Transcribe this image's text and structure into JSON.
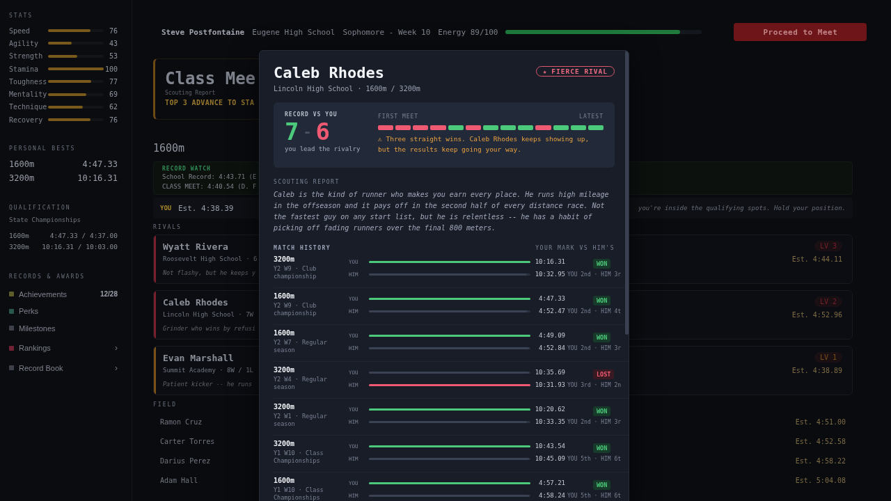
{
  "sidebar": {
    "stats_title": "STATS",
    "stats": [
      {
        "name": "Speed",
        "value": "76",
        "level": 0.76
      },
      {
        "name": "Agility",
        "value": "43",
        "level": 0.43
      },
      {
        "name": "Strength",
        "value": "53",
        "level": 0.53
      },
      {
        "name": "Stamina",
        "value": "100",
        "level": 1.0
      },
      {
        "name": "Toughness",
        "value": "77",
        "level": 0.77
      },
      {
        "name": "Mentality",
        "value": "69",
        "level": 0.69
      },
      {
        "name": "Technique",
        "value": "62",
        "level": 0.62
      },
      {
        "name": "Recovery",
        "value": "76",
        "level": 0.76
      }
    ],
    "bests_title": "PERSONAL BESTS",
    "bests": [
      {
        "event": "1600m",
        "time": "4:47.33"
      },
      {
        "event": "3200m",
        "time": "10:16.31"
      }
    ],
    "qualification_title": "QUALIFICATION",
    "qualification_meet": "State Championships",
    "qualification": [
      {
        "event": "1600m",
        "mark": "4:47.33 / 4:37.00"
      },
      {
        "event": "3200m",
        "mark": "10:16.31 / 10:03.00"
      }
    ],
    "awards_title": "RECORDS & AWARDS",
    "awards": [
      {
        "label": "Achievements",
        "color": "#5e5e2a",
        "count": "12/28"
      },
      {
        "label": "Perks",
        "color": "#27574e"
      },
      {
        "label": "Milestones",
        "color": "#3d4149"
      },
      {
        "label": "Rankings",
        "color": "#722232",
        "chevron": "›"
      },
      {
        "label": "Record Book",
        "color": "#3d4149",
        "chevron": "›"
      }
    ]
  },
  "top_bar": {
    "name": "Steve Postfontaine",
    "school": "Eugene High School",
    "week": "Sophomore - Week 10",
    "energy": {
      "label": "Energy 89/100",
      "level": 0.89
    },
    "button": "Proceed to Meet"
  },
  "meet_card": {
    "title": "Class Mee",
    "subtitle": "Scouting Report",
    "note": "TOP 3 ADVANCE TO STA"
  },
  "event": "1600m",
  "record_watch": {
    "title": "RECORD WATCH",
    "lines": [
      "School Record: 4:43.71 (E",
      "CLASS MEET: 4:40.54 (D. F"
    ]
  },
  "you_row": {
    "tag": "YOU",
    "estimate": "Est. 4:38.39",
    "note": "you're inside the qualifying spots. Hold your position."
  },
  "rivals_title": "RIVALS",
  "rivals": [
    {
      "name": "Wyatt Rivera",
      "detail": "Roosevelt High School · 6",
      "quote": "Not flashy, but he keeps y",
      "level": "LV 3",
      "estimate": "Est. 4:44.11",
      "color": "#7a1f2c"
    },
    {
      "name": "Caleb Rhodes",
      "detail": "Lincoln High School · 7W",
      "quote": "Grinder who wins by refusi",
      "level": "LV 2",
      "estimate": "Est. 4:52.96",
      "color": "#7a1f2c"
    },
    {
      "name": "Evan Marshall",
      "detail": "Summit Academy · 8W / 1L",
      "quote": "Patient kicker -- he runs",
      "level": "LV 1",
      "estimate": "Est. 4:38.89",
      "color": "#7a5218"
    }
  ],
  "field_title": "FIELD",
  "field": [
    {
      "name": "Ramon Cruz",
      "estimate": "Est. 4:51.00"
    },
    {
      "name": "Carter Torres",
      "estimate": "Est. 4:52.58"
    },
    {
      "name": "Darius Perez",
      "estimate": "Est. 4:58.22"
    },
    {
      "name": "Adam Hall",
      "estimate": "Est. 5:04.08"
    }
  ],
  "modal": {
    "name": "Caleb Rhodes",
    "subtitle": "Lincoln High School · 1600m / 3200m",
    "badge": {
      "icon": "★",
      "label": "FIERCE RIVAL"
    },
    "record": {
      "title": "RECORD VS YOU",
      "wins": "7",
      "separator": "-",
      "losses": "6",
      "caption": "you lead the rivalry",
      "first_label": "FIRST MEET",
      "latest_label": "LATEST",
      "results": [
        {
          "color": "#ef5a72"
        },
        {
          "color": "#ef5a72"
        },
        {
          "color": "#ef5a72"
        },
        {
          "color": "#ef5a72"
        },
        {
          "color": "#4cc97a"
        },
        {
          "color": "#ef5a72"
        },
        {
          "color": "#4cc97a"
        },
        {
          "color": "#4cc97a"
        },
        {
          "color": "#4cc97a"
        },
        {
          "color": "#ef5a72"
        },
        {
          "color": "#4cc97a"
        },
        {
          "color": "#4cc97a"
        },
        {
          "color": "#4cc97a"
        }
      ],
      "note": "⚠ Three straight wins. Caleb Rhodes keeps showing up, but the results keep going your way."
    },
    "scouting_title": "SCOUTING REPORT",
    "scouting": "Caleb is the kind of runner who makes you earn every place. He runs high mileage in the offseason and it pays off in the second half of every distance race. Not the fastest guy on any start list, but he is relentless -- he has a habit of picking off fading runners over the final 800 meters.",
    "history_title": "MATCH HISTORY",
    "history_hint": "YOUR MARK VS HIM'S",
    "matches": [
      {
        "event": "3200m",
        "meet": "Y2 W9 · Club championship",
        "you": {
          "label": "YOU",
          "time": "10:16.31",
          "level": 1.0
        },
        "him": {
          "label": "HIM",
          "time": "10:32.95",
          "level": 0.98
        },
        "won": true,
        "badge": "WON",
        "places": "YOU 2nd · HIM 3r"
      },
      {
        "event": "1600m",
        "meet": "Y2 W9 · Club championship",
        "you": {
          "label": "YOU",
          "time": "4:47.33",
          "level": 1.0
        },
        "him": {
          "label": "HIM",
          "time": "4:52.47",
          "level": 0.98
        },
        "won": true,
        "badge": "WON",
        "places": "YOU 2nd · HIM 4t"
      },
      {
        "event": "1600m",
        "meet": "Y2 W7 · Regular season",
        "you": {
          "label": "YOU",
          "time": "4:49.09",
          "level": 1.0
        },
        "him": {
          "label": "HIM",
          "time": "4:52.84",
          "level": 0.99
        },
        "won": true,
        "badge": "WON",
        "places": "YOU 2nd · HIM 3r"
      },
      {
        "event": "3200m",
        "meet": "Y2 W4 · Regular season",
        "you": {
          "label": "YOU",
          "time": "10:35.69",
          "level": 0.99
        },
        "him": {
          "label": "HIM",
          "time": "10:31.93",
          "level": 1.0
        },
        "won": false,
        "badge": "LOST",
        "places": "YOU 3rd · HIM 2n"
      },
      {
        "event": "3200m",
        "meet": "Y2 W1 · Regular season",
        "you": {
          "label": "YOU",
          "time": "10:20.62",
          "level": 1.0
        },
        "him": {
          "label": "HIM",
          "time": "10:33.35",
          "level": 0.98
        },
        "won": true,
        "badge": "WON",
        "places": "YOU 2nd · HIM 3r"
      },
      {
        "event": "3200m",
        "meet": "Y1 W10 · Class Championships",
        "you": {
          "label": "YOU",
          "time": "10:43.54",
          "level": 1.0
        },
        "him": {
          "label": "HIM",
          "time": "10:45.09",
          "level": 0.99
        },
        "won": true,
        "badge": "WON",
        "places": "YOU 5th · HIM 6t"
      },
      {
        "event": "1600m",
        "meet": "Y1 W10 · Class Championships",
        "you": {
          "label": "YOU",
          "time": "4:57.21",
          "level": 1.0
        },
        "him": {
          "label": "HIM",
          "time": "4:58.24",
          "level": 0.99
        },
        "won": true,
        "badge": "WON",
        "places": "YOU 5th · HIM 6t"
      }
    ]
  }
}
